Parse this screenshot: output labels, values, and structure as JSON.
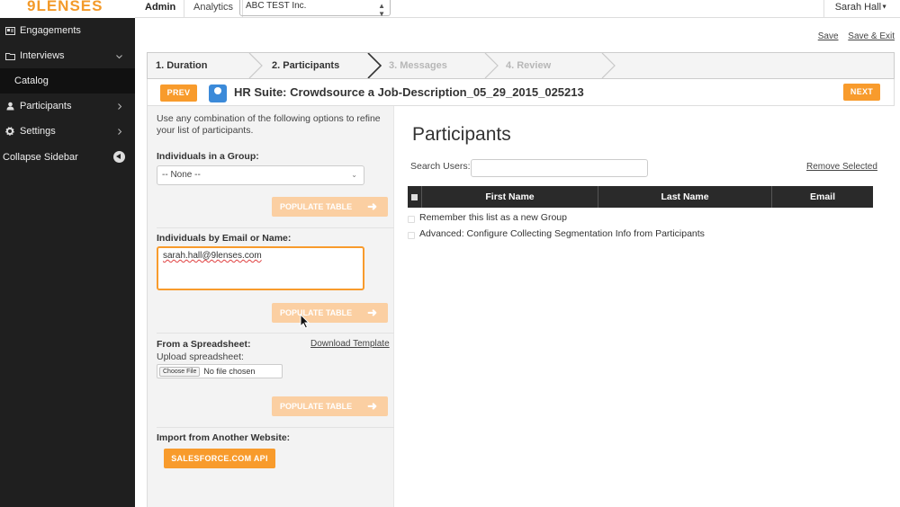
{
  "app": {
    "logo_text": "9LENSES"
  },
  "sidebar": {
    "items": [
      {
        "label": "Engagements",
        "icon": "engagements-icon"
      },
      {
        "label": "Interviews",
        "icon": "folder-icon"
      },
      {
        "label": "Catalog",
        "icon": ""
      },
      {
        "label": "Participants",
        "icon": "user-icon"
      },
      {
        "label": "Settings",
        "icon": "gear-icon"
      }
    ],
    "collapse_label": "Collapse Sidebar"
  },
  "topbar": {
    "admin_tab": "Admin",
    "analytics_tab": "Analytics",
    "org_select_value": "ABC TEST Inc.",
    "user_name": "Sarah Hall"
  },
  "top_links": {
    "save": "Save",
    "save_exit": "Save & Exit"
  },
  "wizard": {
    "steps": [
      {
        "label": "1. Duration",
        "state": "done"
      },
      {
        "label": "2. Participants",
        "state": "current"
      },
      {
        "label": "3. Messages",
        "state": "todo"
      },
      {
        "label": "4. Review",
        "state": "todo"
      }
    ],
    "prev_label": "PREV",
    "next_label": "NEXT",
    "title": "HR Suite: Crowdsource a Job-Description_05_29_2015_025213"
  },
  "left": {
    "intro": "Use any combination of the following options to refine your list of participants.",
    "group_label": "Individuals in a Group:",
    "group_select_value": "-- None --",
    "populate_label": "POPULATE TABLE",
    "email_label": "Individuals by Email or Name:",
    "email_value": "sarah.hall@9lenses.com",
    "spreadsheet_label": "From a Spreadsheet:",
    "download_template": "Download Template",
    "upload_label": "Upload spreadsheet:",
    "choose_file": "Choose File",
    "no_file": "No file chosen",
    "import_label": "Import from Another Website:",
    "salesforce_label": "SALESFORCE.COM API"
  },
  "right": {
    "title": "Participants",
    "search_label": "Search Users:",
    "search_value": "",
    "remove_selected": "Remove Selected",
    "columns": [
      "First Name",
      "Last Name",
      "Email"
    ],
    "options": [
      "Remember this list as a new Group",
      "Advanced: Configure Collecting Segmentation Info from Participants"
    ]
  },
  "colors": {
    "accent": "#f89b2c",
    "accent_disabled": "#fbcfa2",
    "sidebar_bg": "#1f1f1f"
  }
}
